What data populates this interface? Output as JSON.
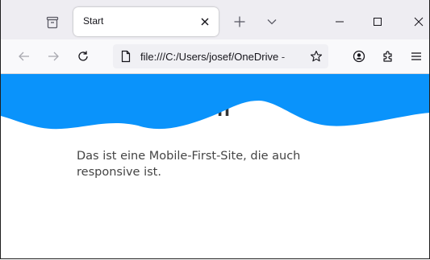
{
  "colors": {
    "wave": "#0a93fb",
    "titlebar": "#eeedf2",
    "navbar": "#f9f9fb",
    "urlbar": "#f0f0f4",
    "text": "#444444"
  },
  "browser": {
    "tab": {
      "title": "Start",
      "close_icon": "close-icon"
    },
    "toolbar_icons": {
      "tab_overview": "tab-overview-icon",
      "new_tab": "plus-icon",
      "list_tabs": "chevron-down-icon",
      "back": "back-arrow-icon",
      "forward": "forward-arrow-icon",
      "reload": "reload-icon",
      "page_info": "page-icon",
      "bookmark": "star-icon",
      "account": "account-icon",
      "extensions": "extensions-icon",
      "menu": "hamburger-menu-icon"
    },
    "window_controls": {
      "minimize": "minimize-icon",
      "maximize": "maximize-icon",
      "close": "close-icon"
    },
    "url": "file:///C:/Users/josef/OneDrive - "
  },
  "page": {
    "heading_visible_fragment": "n",
    "intro_text": "Das ist eine Mobile-First-Site, die auch responsive ist."
  }
}
